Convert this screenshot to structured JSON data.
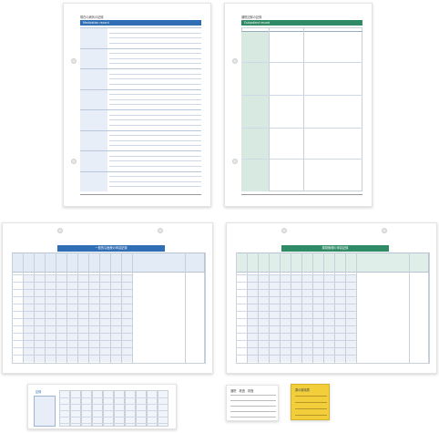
{
  "sheet1": {
    "title": "現在の病状の記録",
    "header_bar": "Medication record",
    "items": [
      "氏名・住所",
      "かかりつけ医",
      "薬の飲み方",
      "アレルギー",
      "副作用歴",
      "既往歴",
      "手術歴",
      "入院歴"
    ]
  },
  "sheet2": {
    "title": "通院記録の記録",
    "header_bar": "Outpatient record",
    "columns": [
      "日時",
      "担当医",
      "症状・経過"
    ]
  },
  "sheet3": {
    "header_bar": "一般的な医療の申請記録"
  },
  "sheet4": {
    "header_bar": "薬剤管理の申請記録"
  },
  "card1": {
    "title": "記録"
  },
  "card2": {
    "title": "通院　検査　検査"
  },
  "card3": {
    "title": "薬の服用表"
  },
  "colors": {
    "blue": "#2f6db5",
    "green": "#2f8a66",
    "yellow": "#f2cf3a"
  }
}
